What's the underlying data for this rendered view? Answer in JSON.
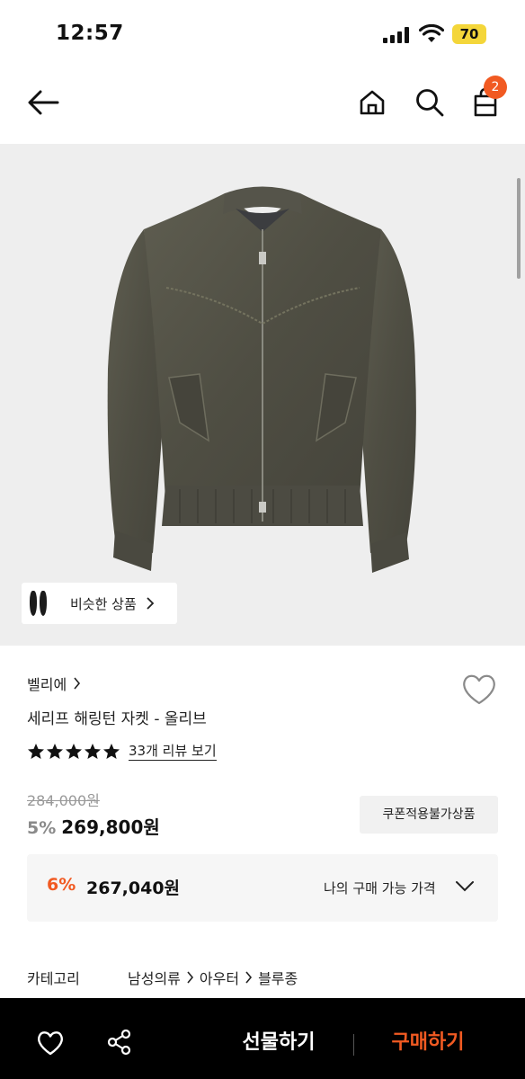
{
  "status_bar": {
    "time": "12:57",
    "battery": "70"
  },
  "nav": {
    "cart_count": "2"
  },
  "image": {
    "similar_label": "비슷한 상품"
  },
  "product": {
    "brand": "벨리에",
    "title": "세리프 해링턴 자켓 - 올리브",
    "rating_stars": 5,
    "review_link": "33개 리뷰 보기",
    "original_price": "284,000원",
    "discount_rate": "5%",
    "sale_price": "269,800원",
    "coupon_badge": "쿠폰적용불가상품",
    "my_price": {
      "rate": "6%",
      "price": "267,040원",
      "label": "나의 구매 가능 가격"
    },
    "category": {
      "label": "카테고리",
      "path": [
        "남성의류",
        "아우터",
        "블루종"
      ]
    }
  },
  "bottom_bar": {
    "gift_label": "선물하기",
    "buy_label": "구매하기"
  },
  "colors": {
    "accent": "#f15a22",
    "bottom_bar_bg": "#000000",
    "image_bg": "#eeeeee"
  }
}
